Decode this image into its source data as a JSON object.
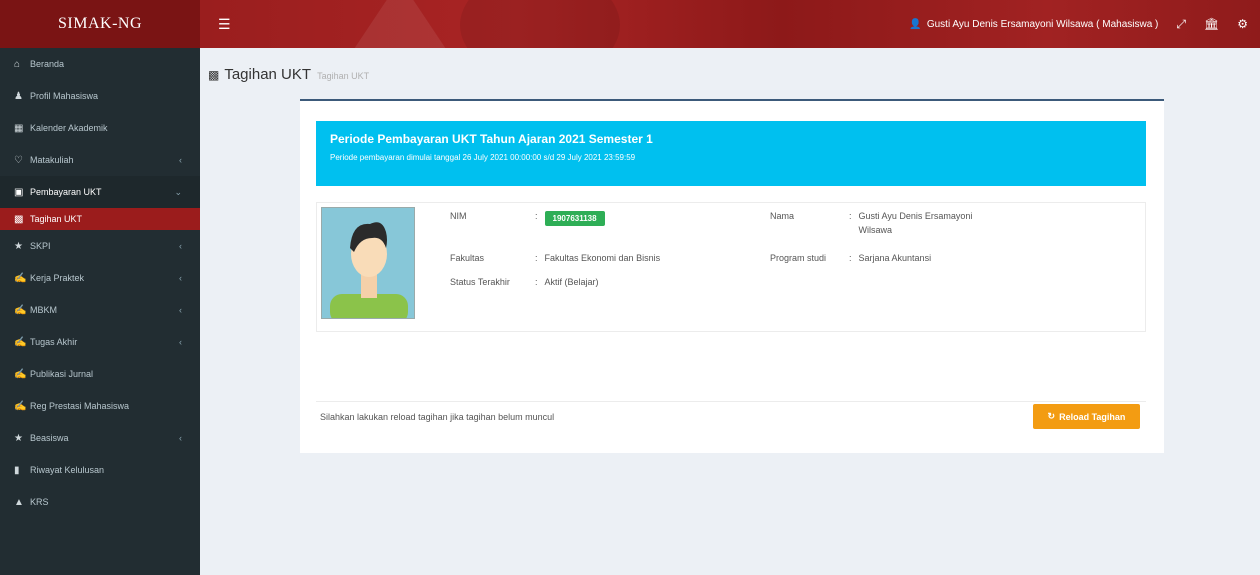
{
  "app": {
    "logo": "SIMAK-NG"
  },
  "topbar": {
    "user_label": "Gusti Ayu Denis Ersamayoni Wilsawa ( Mahasiswa )"
  },
  "sidebar": {
    "items": [
      {
        "label": "Beranda",
        "icon": "home-icon"
      },
      {
        "label": "Profil Mahasiswa",
        "icon": "user-icon"
      },
      {
        "label": "Kalender Akademik",
        "icon": "calendar-icon"
      },
      {
        "label": "Matakuliah",
        "icon": "heart-icon"
      },
      {
        "label": "Pembayaran UKT",
        "icon": "credit-card-icon"
      },
      {
        "label": "Tagihan UKT",
        "icon": "money-icon"
      },
      {
        "label": "SKPI",
        "icon": "star-icon"
      },
      {
        "label": "Kerja Praktek",
        "icon": "graduation-icon"
      },
      {
        "label": "MBKM",
        "icon": "graduation-icon"
      },
      {
        "label": "Tugas Akhir",
        "icon": "graduation-icon"
      },
      {
        "label": "Publikasi Jurnal",
        "icon": "graduation-icon"
      },
      {
        "label": "Reg Prestasi Mahasiswa",
        "icon": "graduation-icon"
      },
      {
        "label": "Beasiswa",
        "icon": "star-icon"
      },
      {
        "label": "Riwayat Kelulusan",
        "icon": "bookmark-icon"
      },
      {
        "label": "KRS",
        "icon": "sitemap-icon"
      }
    ]
  },
  "page": {
    "title": "Tagihan UKT",
    "subtitle": "Tagihan UKT"
  },
  "banner": {
    "title": "Periode Pembayaran UKT Tahun Ajaran 2021 Semester 1",
    "text": "Periode pembayaran dimulai tanggal 26 July 2021 00:00:00 s/d 29 July 2021 23:59:59"
  },
  "profile": {
    "nim_label": "NIM",
    "nim_value": "1907631138",
    "nama_label": "Nama",
    "nama_value_line1": "Gusti Ayu Denis Ersamayoni",
    "nama_value_line2": "Wilsawa",
    "fakultas_label": "Fakultas",
    "fakultas_value": "Fakultas Ekonomi dan Bisnis",
    "prodi_label": "Program studi",
    "prodi_value": "Sarjana Akuntansi",
    "status_label": "Status Terakhir",
    "status_value": "Aktif (Belajar)",
    "separator": ":"
  },
  "footer": {
    "hint": "Silahkan lakukan reload tagihan jika tagihan belum muncul",
    "button": "Reload Tagihan"
  },
  "colors": {
    "topbar": "#8b1a1a",
    "sidebar": "#222d32",
    "banner": "#00c0ef",
    "nim_badge": "#2eae56",
    "reload_button": "#f39c12",
    "active_sub": "#9b1c1c"
  }
}
